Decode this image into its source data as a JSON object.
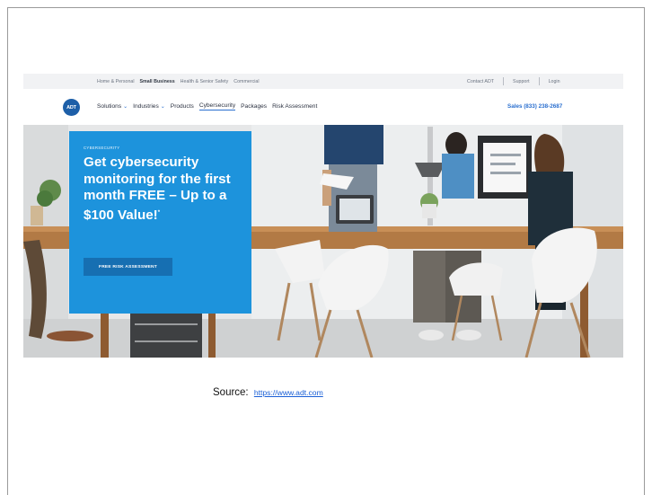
{
  "utility_bar": {
    "left_links": [
      {
        "label": "Home & Personal",
        "active": false
      },
      {
        "label": "Small Business",
        "active": true
      },
      {
        "label": "Health & Senior Safety",
        "active": false
      },
      {
        "label": "Commercial",
        "active": false
      }
    ],
    "right_links": [
      "Contact ADT",
      "Support",
      "Login"
    ]
  },
  "nav": {
    "logo_text": "ADT",
    "items": [
      {
        "label": "Solutions",
        "has_dropdown": true
      },
      {
        "label": "Industries",
        "has_dropdown": true
      },
      {
        "label": "Products",
        "has_dropdown": false
      },
      {
        "label": "Cybersecurity",
        "has_dropdown": false,
        "current": true
      },
      {
        "label": "Packages",
        "has_dropdown": false
      },
      {
        "label": "Risk Assessment",
        "has_dropdown": false
      }
    ],
    "sales_phone": "Sales (833) 238-2687"
  },
  "hero": {
    "eyebrow": "CYBERSECURITY",
    "headline": "Get cybersecurity monitoring for the first month FREE – Up to a $100 Value!",
    "footnote_mark": "*",
    "cta_label": "FREE RISK ASSESSMENT"
  },
  "source": {
    "label": "Source:",
    "link_text": "https://www.adt.com"
  },
  "colors": {
    "brand_blue": "#1d5fa8",
    "promo_blue": "#1d93dc",
    "cta_blue": "#166fb2",
    "link_blue": "#2a6fcf"
  },
  "icons": {
    "dropdown": "chevron-down-icon",
    "logo": "adt-logo-icon"
  }
}
